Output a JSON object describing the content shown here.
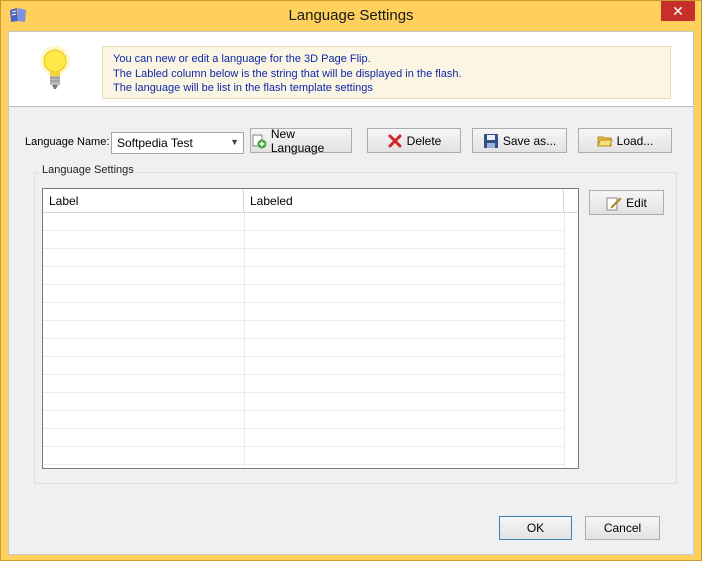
{
  "window": {
    "title": "Language Settings",
    "close_label": "✕"
  },
  "info": {
    "line1": "You can new or edit  a language for the 3D Page Flip.",
    "line2": "The Labled column below is the string that will be displayed in the flash.",
    "line3": "The language will be list in the flash template settings"
  },
  "language": {
    "label": "Language Name:",
    "selected": "Softpedia Test"
  },
  "toolbar": {
    "new_label": "New Language",
    "delete_label": "Delete",
    "save_label": "Save as...",
    "load_label": "Load..."
  },
  "group": {
    "title": "Language Settings"
  },
  "grid": {
    "columns": [
      "Label",
      "Labeled"
    ],
    "rows": []
  },
  "edit": {
    "label": "Edit"
  },
  "footer": {
    "ok_label": "OK",
    "cancel_label": "Cancel"
  },
  "icons": {
    "app": "book-icon",
    "bulb": "lightbulb-icon",
    "new": "add-icon",
    "delete": "delete-icon",
    "save": "save-icon",
    "load": "folder-open-icon",
    "edit": "edit-icon"
  },
  "colors": {
    "titlebar": "#ffd15c",
    "close": "#c7302a",
    "info_text": "#0f28a8",
    "info_bg": "#fbf6e4"
  }
}
